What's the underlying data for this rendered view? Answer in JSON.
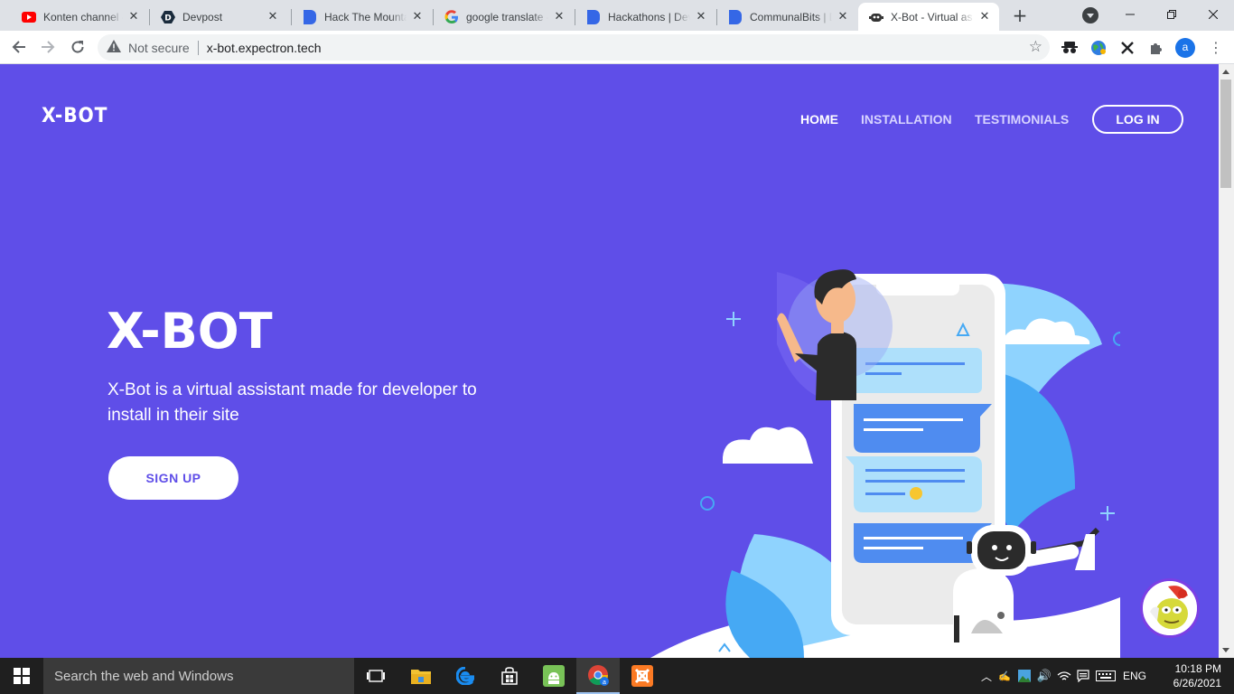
{
  "browser": {
    "tabs": [
      {
        "title": "Konten channel -",
        "icon": "youtube-icon"
      },
      {
        "title": "Devpost",
        "icon": "devpost-icon"
      },
      {
        "title": "Hack The Mounta",
        "icon": "devpost-icon"
      },
      {
        "title": "google translate -",
        "icon": "google-icon"
      },
      {
        "title": "Hackathons | Dev",
        "icon": "devpost-icon"
      },
      {
        "title": "CommunalBits | D",
        "icon": "devpost-icon"
      },
      {
        "title": "X-Bot - Virtual as",
        "icon": "xbot-icon"
      }
    ],
    "active_tab": 6,
    "address": {
      "security": "Not secure",
      "url": "x-bot.expectron.tech"
    },
    "profile_initial": "a"
  },
  "site": {
    "brand": "X-BOT",
    "nav": [
      {
        "label": "HOME",
        "active": true
      },
      {
        "label": "INSTALLATION",
        "active": false
      },
      {
        "label": "TESTIMONIALS",
        "active": false
      }
    ],
    "login_label": "LOG IN",
    "hero": {
      "title": "X-BOT",
      "description": "X-Bot is a virtual assistant made for developer to install in their site",
      "signup_label": "SIGN UP"
    },
    "colors": {
      "background": "#5f4ee8",
      "accent_light": "#8fd3fe",
      "accent_blue": "#4f8cf0",
      "white": "#ffffff"
    }
  },
  "taskbar": {
    "search_placeholder": "Search the web and Windows",
    "language": "ENG",
    "time": "10:18 PM",
    "date": "6/26/2021"
  }
}
